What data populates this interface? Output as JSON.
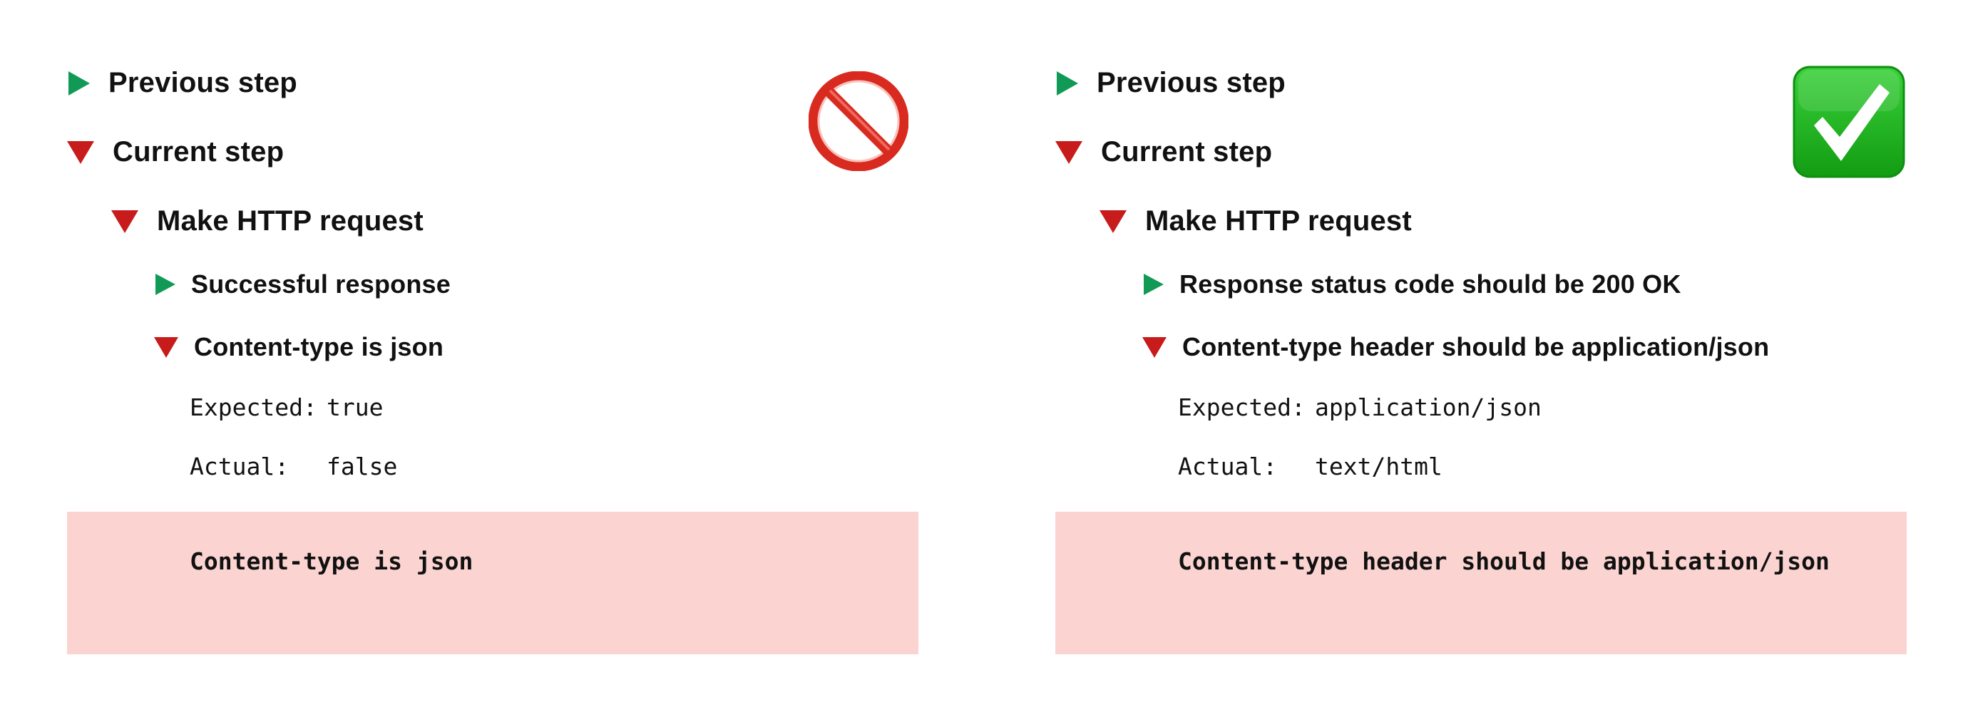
{
  "colors": {
    "collapsed_triangle": "#119a55",
    "expanded_triangle": "#c81b1b",
    "failure_background": "#fbd4d1",
    "check_badge": "#1db81b",
    "prohibited_badge": "#d92a1f"
  },
  "left": {
    "badge_icon": "prohibited-icon",
    "previous_step": "Previous step",
    "current_step": "Current step",
    "request": "Make HTTP request",
    "assertion_passed": "Successful response",
    "assertion_failed": "Content-type is json",
    "expected_label": "Expected:",
    "expected_value": "true",
    "actual_label": "Actual:",
    "actual_value": "false",
    "failure_message": "Content-type is json"
  },
  "right": {
    "badge_icon": "check-mark-icon",
    "previous_step": "Previous step",
    "current_step": "Current step",
    "request": "Make HTTP request",
    "assertion_passed": "Response status code should be 200 OK",
    "assertion_failed": "Content-type header should be application/json",
    "expected_label": "Expected:",
    "expected_value": "application/json",
    "actual_label": "Actual:",
    "actual_value": "text/html",
    "failure_message": "Content-type header should be application/json"
  }
}
